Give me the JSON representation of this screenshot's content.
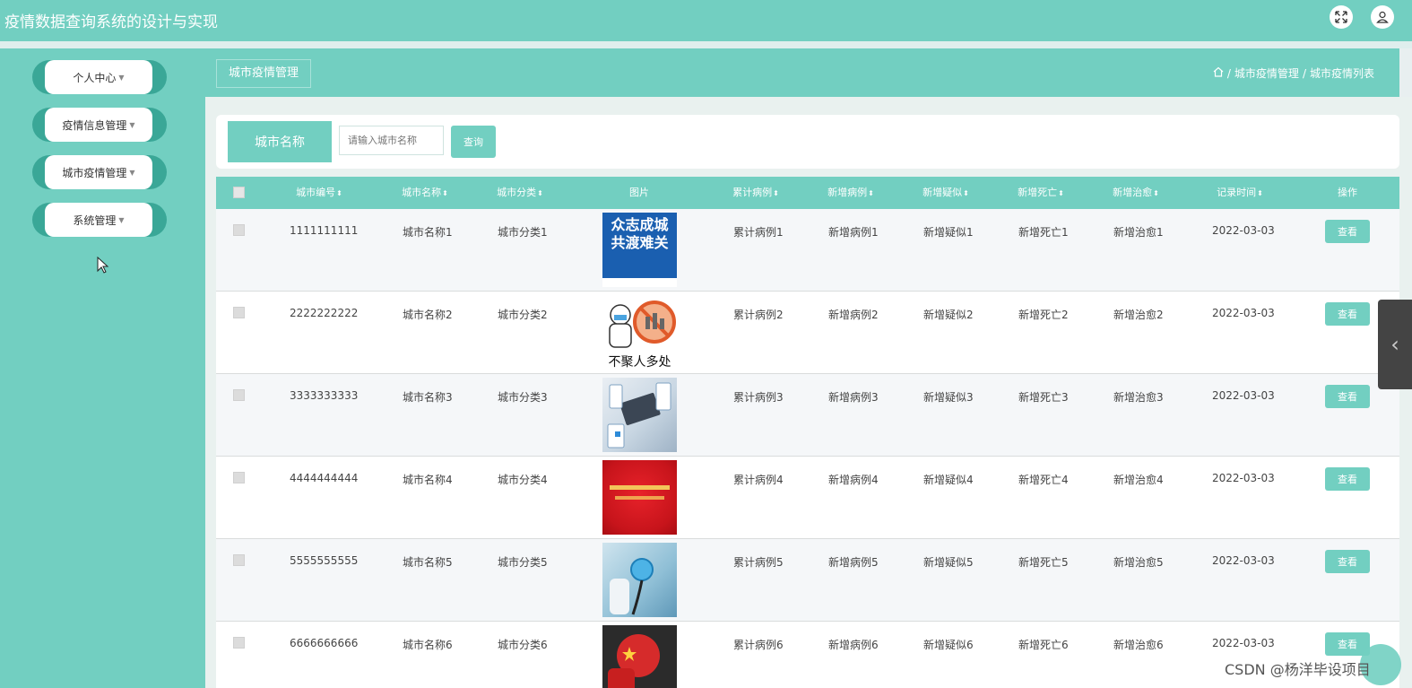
{
  "app": {
    "title": "疫情数据查询系统的设计与实现"
  },
  "topbar_icons": [
    "fullscreen-icon",
    "user-icon"
  ],
  "sidebar": {
    "items": [
      {
        "label": "个人中心"
      },
      {
        "label": "疫情信息管理"
      },
      {
        "label": "城市疫情管理"
      },
      {
        "label": "系统管理"
      }
    ]
  },
  "header": {
    "title": "城市疫情管理",
    "breadcrumb": [
      "城市疫情管理",
      "城市疫情列表"
    ],
    "breadcrumb_sep": "/"
  },
  "search": {
    "label": "城市名称",
    "placeholder": "请输入城市名称",
    "button": "查询"
  },
  "table": {
    "columns": [
      "城市编号",
      "城市名称",
      "城市分类",
      "图片",
      "累计病例",
      "新增病例",
      "新增疑似",
      "新增死亡",
      "新增治愈",
      "记录时间",
      "操作"
    ],
    "rows": [
      {
        "id": "1111111111",
        "name": "城市名称1",
        "category": "城市分类1",
        "image_caption": "众志成城\n共渡难关",
        "total": "累计病例1",
        "new_cases": "新增病例1",
        "new_suspected": "新增疑似1",
        "new_deaths": "新增死亡1",
        "new_recovered": "新增治愈1",
        "date": "2022-03-03",
        "action": "查看"
      },
      {
        "id": "2222222222",
        "name": "城市名称2",
        "category": "城市分类2",
        "image_caption": "不聚人多处",
        "total": "累计病例2",
        "new_cases": "新增病例2",
        "new_suspected": "新增疑似2",
        "new_deaths": "新增死亡2",
        "new_recovered": "新增治愈2",
        "date": "2022-03-03",
        "action": "查看"
      },
      {
        "id": "3333333333",
        "name": "城市名称3",
        "category": "城市分类3",
        "image_caption": "",
        "total": "累计病例3",
        "new_cases": "新增病例3",
        "new_suspected": "新增疑似3",
        "new_deaths": "新增死亡3",
        "new_recovered": "新增治愈3",
        "date": "2022-03-03",
        "action": "查看"
      },
      {
        "id": "4444444444",
        "name": "城市名称4",
        "category": "城市分类4",
        "image_caption": "",
        "total": "累计病例4",
        "new_cases": "新增病例4",
        "new_suspected": "新增疑似4",
        "new_deaths": "新增死亡4",
        "new_recovered": "新增治愈4",
        "date": "2022-03-03",
        "action": "查看"
      },
      {
        "id": "5555555555",
        "name": "城市名称5",
        "category": "城市分类5",
        "image_caption": "",
        "total": "累计病例5",
        "new_cases": "新增病例5",
        "new_suspected": "新增疑似5",
        "new_deaths": "新增死亡5",
        "new_recovered": "新增治愈5",
        "date": "2022-03-03",
        "action": "查看"
      },
      {
        "id": "6666666666",
        "name": "城市名称6",
        "category": "城市分类6",
        "image_caption": "",
        "total": "累计病例6",
        "new_cases": "新增病例6",
        "new_suspected": "新增疑似6",
        "new_deaths": "新增死亡6",
        "new_recovered": "新增治愈6",
        "date": "2022-03-03",
        "action": "查看"
      }
    ]
  },
  "watermark": "CSDN @杨洋毕设项目",
  "colors": {
    "accent": "#72cfc1",
    "accent_dark": "#3aa797"
  }
}
